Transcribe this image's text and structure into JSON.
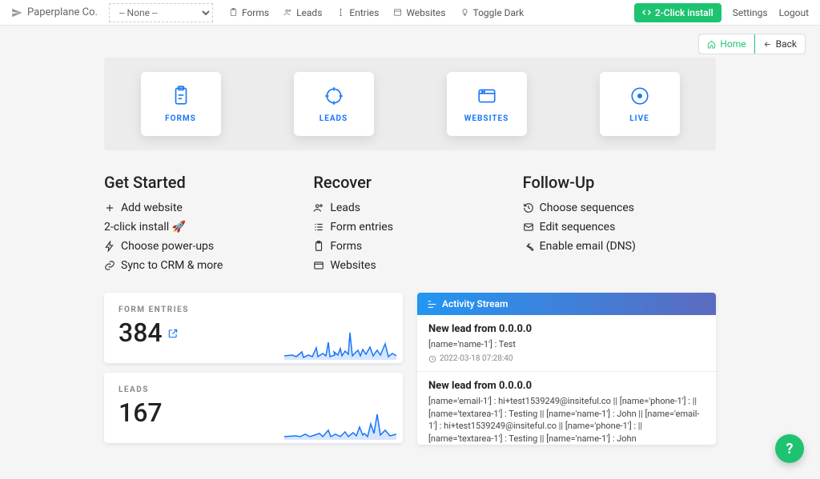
{
  "brand": "Paperplane Co.",
  "site_select_label": "-- None --",
  "nav": {
    "items": [
      "Forms",
      "Leads",
      "Entries",
      "Websites",
      "Toggle Dark"
    ],
    "install_btn": "2-Click install",
    "settings": "Settings",
    "logout": "Logout"
  },
  "crumbs": {
    "home": "Home",
    "back": "Back"
  },
  "hero": {
    "forms": "FORMS",
    "leads": "LEADS",
    "websites": "WEBSITES",
    "live": "LIVE"
  },
  "sections": {
    "get_started": {
      "title": "Get Started",
      "links": [
        "Add website",
        "2-click install 🚀",
        "Choose power-ups",
        "Sync to CRM & more"
      ]
    },
    "recover": {
      "title": "Recover",
      "links": [
        "Leads",
        "Form entries",
        "Forms",
        "Websites"
      ]
    },
    "followup": {
      "title": "Follow-Up",
      "links": [
        "Choose sequences",
        "Edit sequences",
        "Enable email (DNS)"
      ]
    }
  },
  "stats": {
    "form_entries": {
      "label": "FORM ENTRIES",
      "value": "384"
    },
    "leads": {
      "label": "LEADS",
      "value": "167"
    }
  },
  "activity": {
    "title": "Activity Stream",
    "items": [
      {
        "title": "New lead from 0.0.0.0",
        "body": "[name='name-1'] : Test",
        "ts": "2022-03-18 07:28:40"
      },
      {
        "title": "New lead from 0.0.0.0",
        "body": "[name='email-1'] : hi+test1539249@insiteful.co || [name='phone-1'] : || [name='textarea-1'] : Testing || [name='name-1'] : John || [name='email-1'] : hi+test1539249@insiteful.co || [name='phone-1'] : || [name='textarea-1'] : Testing || [name='name-1'] : John",
        "ts": ""
      }
    ]
  },
  "fab": "?"
}
